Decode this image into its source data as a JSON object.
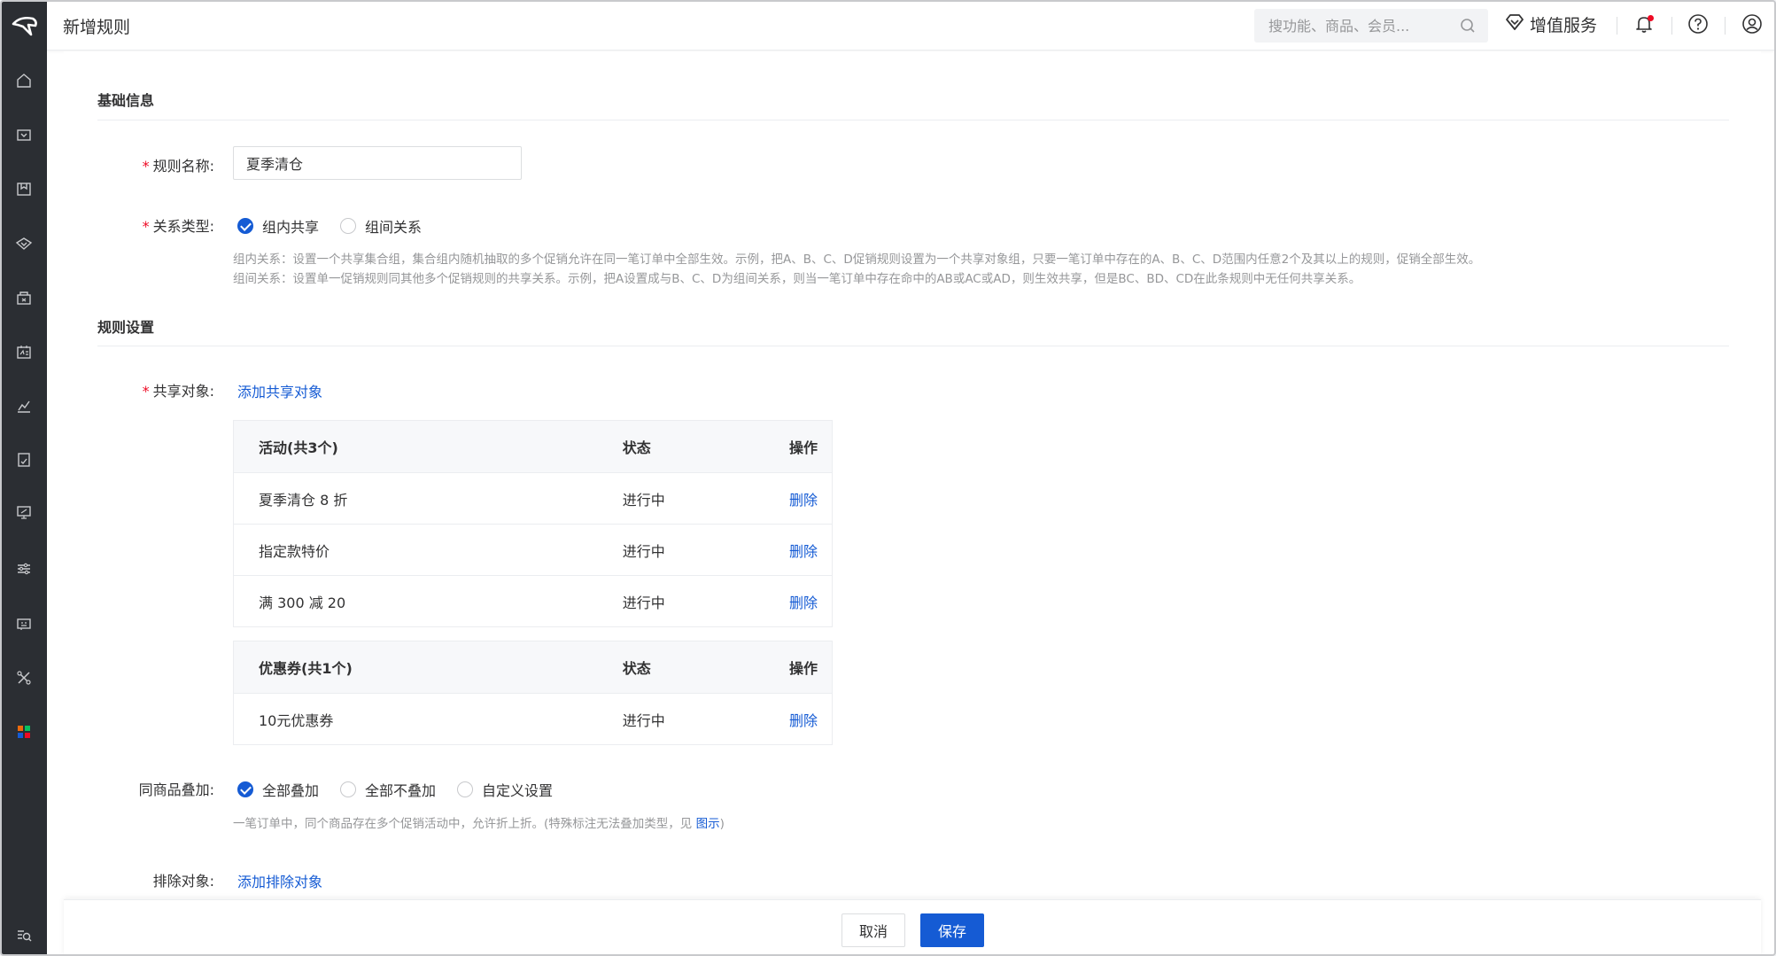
{
  "header": {
    "page_title": "新增规则",
    "search_placeholder": "搜功能、商品、会员...",
    "value_added_label": "增值服务"
  },
  "sidebar": {
    "icons": [
      "home-icon",
      "store-icon",
      "goods-icon",
      "orders-icon",
      "customers-icon",
      "member-card-icon",
      "data-icon",
      "finance-icon",
      "marketing-icon",
      "settings-icon",
      "message-icon",
      "tools-icon",
      "apps-icon",
      "search-menu-icon"
    ]
  },
  "basic_info": {
    "section_title": "基础信息",
    "rule_name_label": "规则名称:",
    "rule_name_value": "夏季清仓",
    "relation_type_label": "关系类型:",
    "relation_options": [
      {
        "label": "组内共享",
        "checked": true
      },
      {
        "label": "组间关系",
        "checked": false
      }
    ],
    "help_line1": "组内关系：设置一个共享集合组，集合组内随机抽取的多个促销允许在同一笔订单中全部生效。示例，把A、B、C、D促销规则设置为一个共享对象组，只要一笔订单中存在的A、B、C、D范围内任意2个及其以上的规则，促销全部生效。",
    "help_line2": "组间关系：设置单一促销规则同其他多个促销规则的共享关系。示例，把A设置成与B、C、D为组间关系，则当一笔订单中存在命中的AB或AC或AD，则生效共享，但是BC、BD、CD在此条规则中无任何共享关系。"
  },
  "rule_settings": {
    "section_title": "规则设置",
    "share_target_label": "共享对象:",
    "add_share_link": "添加共享对象",
    "activity_table": {
      "headers": [
        "活动(共3个)",
        "状态",
        "操作"
      ],
      "rows": [
        {
          "name": "夏季清仓 8 折",
          "status": "进行中",
          "action": "删除"
        },
        {
          "name": "指定款特价",
          "status": "进行中",
          "action": "删除"
        },
        {
          "name": "满 300 减 20",
          "status": "进行中",
          "action": "删除"
        }
      ]
    },
    "coupon_table": {
      "headers": [
        "优惠券(共1个)",
        "状态",
        "操作"
      ],
      "rows": [
        {
          "name": "10元优惠券",
          "status": "进行中",
          "action": "删除"
        }
      ]
    },
    "stack_label": "同商品叠加:",
    "stack_options": [
      {
        "label": "全部叠加",
        "checked": true
      },
      {
        "label": "全部不叠加",
        "checked": false
      },
      {
        "label": "自定义设置",
        "checked": false
      }
    ],
    "stack_help": "一笔订单中，同个商品存在多个促销活动中，允许折上折。(特殊标注无法叠加类型，见",
    "stack_help_link": "图示",
    "stack_help_end": ")",
    "exclude_label": "排除对象:",
    "add_exclude_link": "添加排除对象"
  },
  "footer": {
    "cancel_label": "取消",
    "save_label": "保存"
  },
  "colors": {
    "primary": "#155bd4",
    "required": "#ee0a24",
    "sidebar_bg": "#2b2e33"
  }
}
